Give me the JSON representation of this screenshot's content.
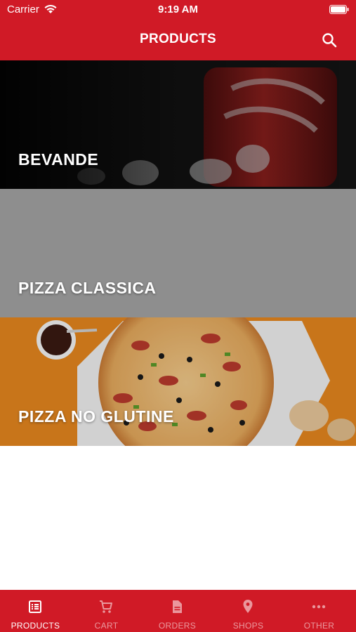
{
  "status_bar": {
    "carrier": "Carrier",
    "time": "9:19 AM"
  },
  "header": {
    "title": "PRODUCTS",
    "search_icon": "search-icon"
  },
  "categories": [
    {
      "label": "BEVANDE",
      "image": "cola-can-with-ice-photo"
    },
    {
      "label": "PIZZA CLASSICA",
      "image": "grey-placeholder"
    },
    {
      "label": "PIZZA NO GLUTINE",
      "image": "pizza-on-orange-background-photo"
    }
  ],
  "tabs": [
    {
      "label": "PRODUCTS",
      "icon": "list-icon",
      "active": true
    },
    {
      "label": "CART",
      "icon": "cart-icon",
      "active": false
    },
    {
      "label": "ORDERS",
      "icon": "document-icon",
      "active": false
    },
    {
      "label": "SHOPS",
      "icon": "location-pin-icon",
      "active": false
    },
    {
      "label": "OTHER",
      "icon": "more-dots-icon",
      "active": false
    }
  ],
  "colors": {
    "brand": "#d01a26",
    "tab_active": "#ffffff",
    "tab_inactive": "rgba(255,255,255,0.55)"
  }
}
